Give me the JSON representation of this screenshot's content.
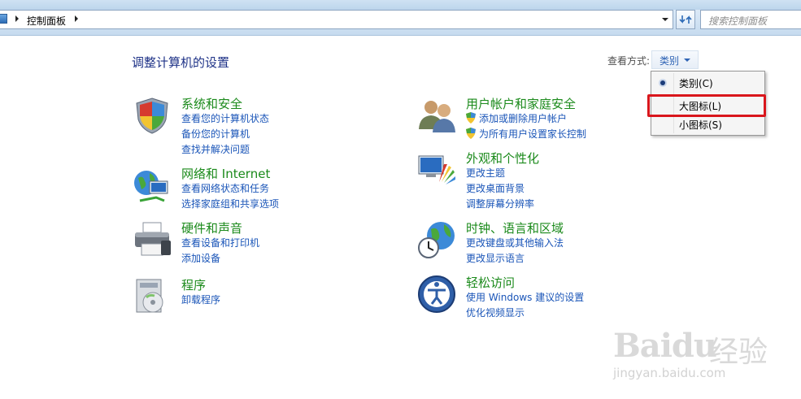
{
  "address_bar": {
    "breadcrumb": "控制面板",
    "search_placeholder": "搜索控制面板"
  },
  "page": {
    "title": "调整计算机的设置",
    "view_by_label": "查看方式:",
    "view_by_value": "类别"
  },
  "view_menu": {
    "items": [
      {
        "label": "类别(C)",
        "selected": true
      },
      {
        "label": "大图标(L)",
        "selected": false,
        "highlighted": true
      },
      {
        "label": "小图标(S)",
        "selected": false
      }
    ]
  },
  "categories": [
    {
      "icon": "shield-icon",
      "title": "系统和安全",
      "links": [
        "查看您的计算机状态",
        "备份您的计算机",
        "查找并解决问题"
      ]
    },
    {
      "icon": "users-icon",
      "title": "用户帐户和家庭安全",
      "links": [
        "添加或删除用户帐户",
        "为所有用户设置家长控制"
      ]
    },
    {
      "icon": "network-icon",
      "title": "网络和 Internet",
      "links": [
        "查看网络状态和任务",
        "选择家庭组和共享选项"
      ]
    },
    {
      "icon": "appearance-icon",
      "title": "外观和个性化",
      "links": [
        "更改主题",
        "更改桌面背景",
        "调整屏幕分辨率"
      ]
    },
    {
      "icon": "printer-icon",
      "title": "硬件和声音",
      "links": [
        "查看设备和打印机",
        "添加设备"
      ]
    },
    {
      "icon": "clock-globe-icon",
      "title": "时钟、语言和区域",
      "links": [
        "更改键盘或其他输入法",
        "更改显示语言"
      ]
    },
    {
      "icon": "programs-icon",
      "title": "程序",
      "links": [
        "卸载程序"
      ]
    },
    {
      "icon": "ease-of-access-icon",
      "title": "轻松访问",
      "links": [
        "使用 Windows 建议的设置",
        "优化视频显示"
      ]
    }
  ],
  "watermark": {
    "brand": "Baidu",
    "cn": "经验",
    "url": "jingyan.baidu.com"
  },
  "colors": {
    "category_title": "#1b8a1b",
    "link": "#1a55b8",
    "page_title": "#1e3287",
    "highlight": "#d9161c"
  }
}
